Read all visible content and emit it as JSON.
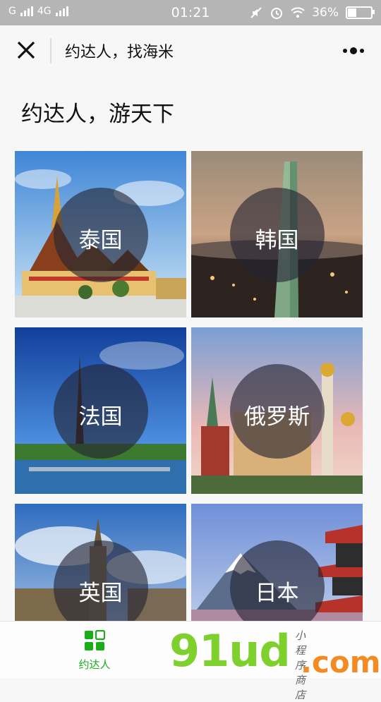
{
  "status": {
    "carrier1": "G",
    "carrier2": "4G",
    "time": "01:21",
    "battery": "36%",
    "battery_level": 0.36
  },
  "nav": {
    "title": "约达人，找海米",
    "close_icon": "close-icon",
    "more_icon": "more-icon"
  },
  "heading": "约达人，游天下",
  "destinations": [
    {
      "label": "泰国",
      "scene": "thai-temple"
    },
    {
      "label": "韩国",
      "scene": "korean-city-night"
    },
    {
      "label": "法国",
      "scene": "eiffel-tower"
    },
    {
      "label": "俄罗斯",
      "scene": "moscow-kremlin"
    },
    {
      "label": "英国",
      "scene": "big-ben"
    },
    {
      "label": "日本",
      "scene": "mount-fuji-pagoda"
    }
  ],
  "tabbar": {
    "items": [
      {
        "label": "约达人",
        "icon": "grid-icon",
        "active": true
      }
    ]
  },
  "watermark": {
    "text": "91ud",
    "com": ".com",
    "small": "小程序商店"
  },
  "colors": {
    "accent": "#1aad19",
    "circle": "rgba(35,35,50,0.62)"
  }
}
